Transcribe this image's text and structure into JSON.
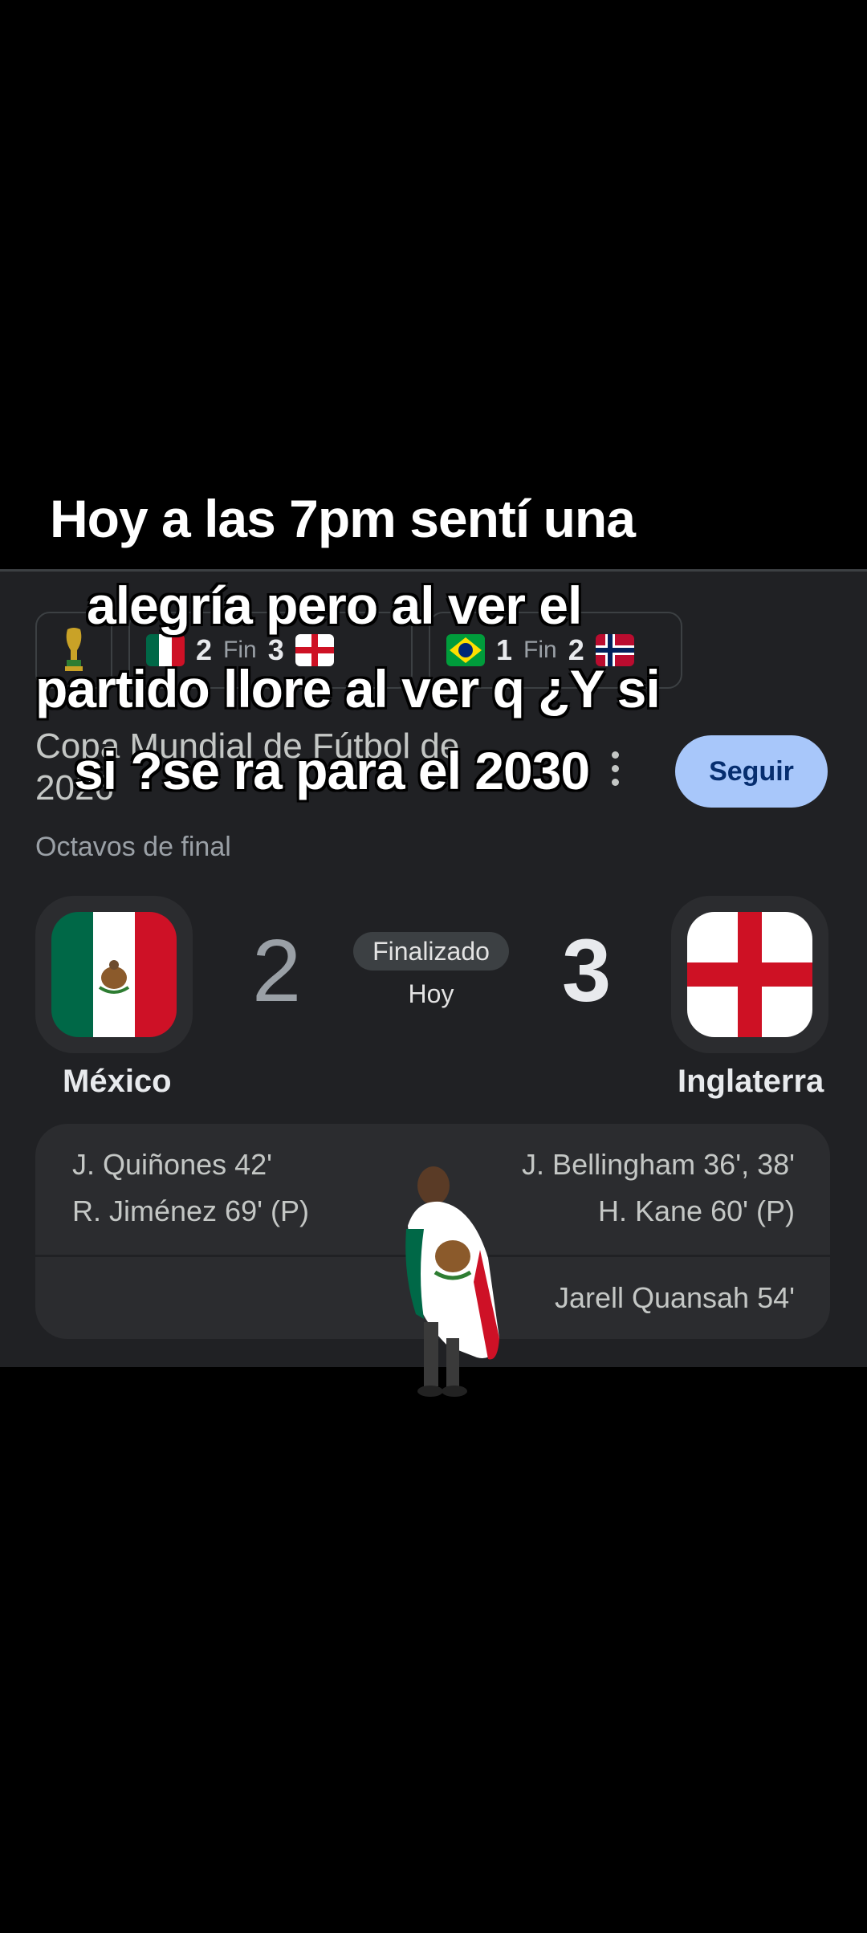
{
  "caption": {
    "line1": "Hoy a las 7pm sentí una",
    "line2": "alegría pero al ver el",
    "line3": "partido llore al ver q ¿Y si",
    "line4": "si ?se ra para el 2030"
  },
  "chips": [
    {
      "home_score": "2",
      "status": "Fin",
      "away_score": "3"
    },
    {
      "home_score": "1",
      "status": "Fin",
      "away_score": "2"
    }
  ],
  "header": {
    "title_line1": "Copa Mundial de Fútbol de",
    "title_line2": "2026",
    "follow_label": "Seguir",
    "stage": "Octavos de final"
  },
  "match": {
    "home_team": "México",
    "away_team": "Inglaterra",
    "home_score": "2",
    "away_score": "3",
    "status": "Finalizado",
    "date": "Hoy"
  },
  "scorers": {
    "home": [
      "J. Quiñones 42'",
      "R. Jiménez 69' (P)"
    ],
    "away": [
      "J. Bellingham 36', 38'",
      "H. Kane 60' (P)"
    ],
    "own_goal_away": "Jarell Quansah 54'"
  },
  "colors": {
    "background": "#000000",
    "card": "#202124",
    "follow_button": "#a8c7fa",
    "mexico_green": "#006847",
    "mexico_red": "#ce1126",
    "england_red": "#ce1124"
  }
}
